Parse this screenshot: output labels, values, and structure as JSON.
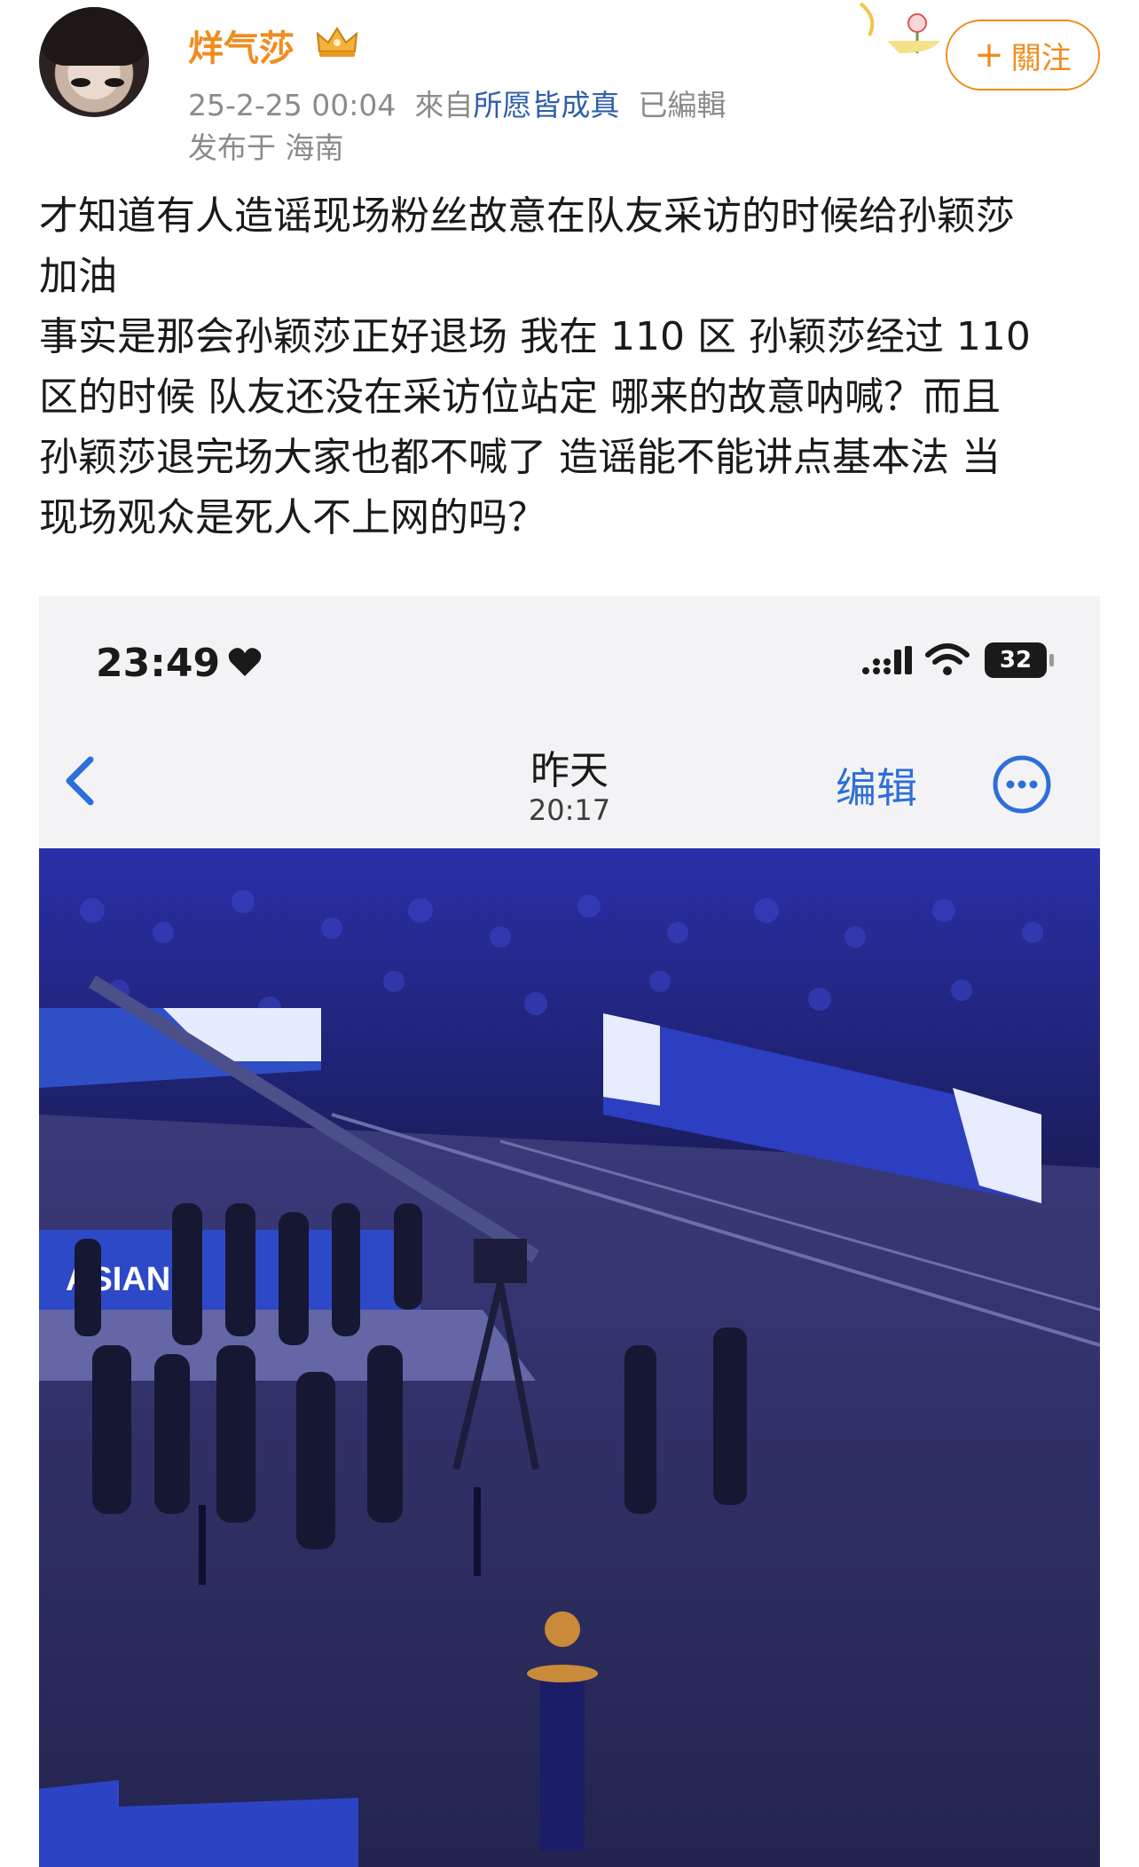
{
  "post": {
    "username": "烊气莎",
    "timestamp": "25-2-25 00:04",
    "source_prefix": "來自",
    "source": "所愿皆成真",
    "edited": "已編輯",
    "location": "发布于 海南",
    "follow_label": "關注",
    "text_lines": [
      "才知道有人造谣现场粉丝故意在队友采访的时候给孙颖莎",
      "加油",
      "事实是那会孙颖莎正好退场 我在 110 区 孙颖莎经过 110",
      "区的时候 队友还没在采访位站定 哪来的故意呐喊？而且",
      "孙颖莎退完场大家也都不喊了 造谣能不能讲点基本法 当",
      "现场观众是死人不上网的吗？"
    ]
  },
  "screenshot": {
    "clock": "23:49",
    "battery": "32",
    "nav_date": "昨天",
    "nav_time": "20:17",
    "edit_label": "编辑"
  },
  "arena": {
    "board_text": "ASIAN"
  }
}
